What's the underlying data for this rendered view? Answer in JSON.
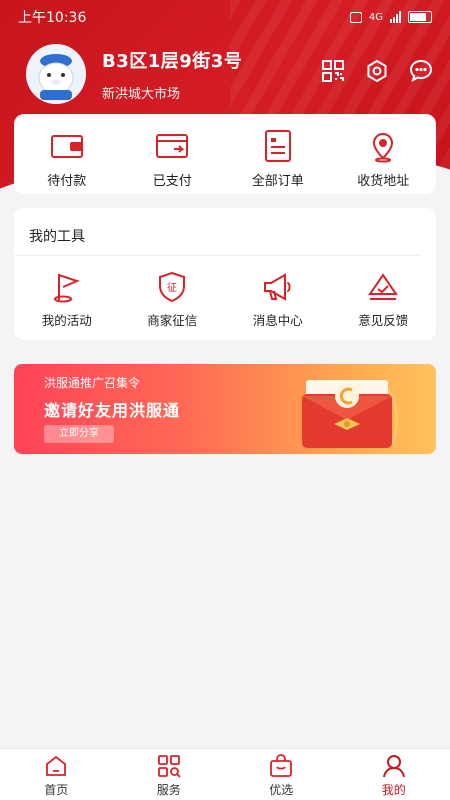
{
  "status_bar": {
    "time": "上午10:36",
    "network": "4G",
    "battery_label": "100"
  },
  "profile": {
    "name": "B3区1层9街3号",
    "market": "新洪城大市场"
  },
  "header_icons": [
    "qr-code-icon",
    "settings-icon",
    "message-icon"
  ],
  "orders": [
    {
      "label": "待付款",
      "icon": "wallet-icon"
    },
    {
      "label": "已支付",
      "icon": "card-paid-icon"
    },
    {
      "label": "全部订单",
      "icon": "order-list-icon"
    },
    {
      "label": "收货地址",
      "icon": "location-pin-icon"
    }
  ],
  "tools": {
    "title": "我的工具",
    "items": [
      {
        "label": "我的活动",
        "icon": "flag-icon"
      },
      {
        "label": "商家征信",
        "icon": "shield-credit-icon"
      },
      {
        "label": "消息中心",
        "icon": "megaphone-icon"
      },
      {
        "label": "意见反馈",
        "icon": "feedback-icon"
      }
    ]
  },
  "banner": {
    "title": "洪服通推广召集令",
    "headline": "邀请好友用洪服通",
    "button": "立即分享"
  },
  "tabs": [
    {
      "label": "首页",
      "icon": "home-icon",
      "active": false
    },
    {
      "label": "服务",
      "icon": "grid-service-icon",
      "active": false
    },
    {
      "label": "优选",
      "icon": "shopping-bag-icon",
      "active": false
    },
    {
      "label": "我的",
      "icon": "person-icon",
      "active": true
    }
  ],
  "colors": {
    "brand": "#c8161e",
    "icon_red": "#d8232a",
    "background": "#f4f4f6"
  }
}
